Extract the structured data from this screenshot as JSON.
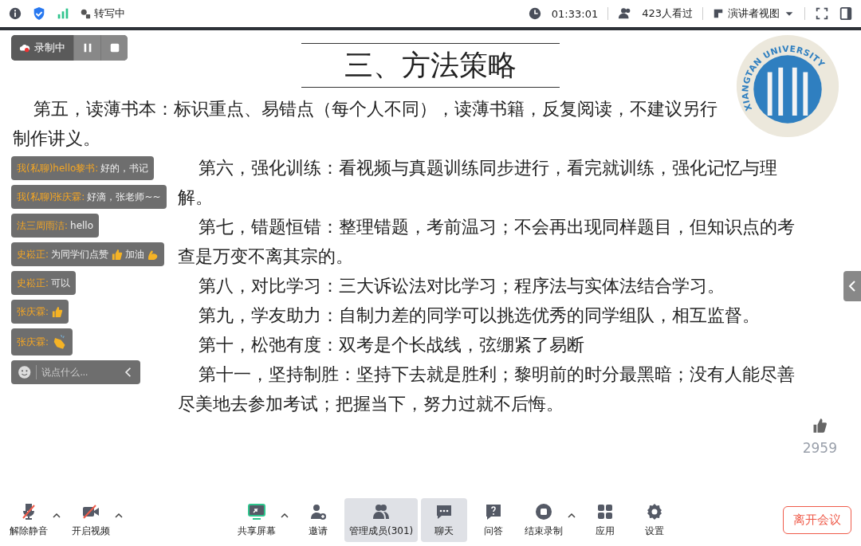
{
  "status_bar": {
    "transcribing": "转写中",
    "time": "01:33:01",
    "viewers": "423人看过",
    "view_mode": "演讲者视图"
  },
  "recording": {
    "label": "录制中"
  },
  "slide": {
    "title": "三、方法策略",
    "logo_text": "XIANGTAN UNIVERSITY",
    "paragraphs": [
      "第五，读薄书本：标识重点、易错点（每个人不同），读薄书籍，反复阅读，不建议另行制作讲义。",
      "第六，强化训练：看视频与真题训练同步进行，看完就训练，强化记忆与理解。",
      "第七，错题恒错：整理错题，考前温习；不会再出现同样题目，但知识点的考查是万变不离其宗的。",
      "第八，对比学习：三大诉讼法对比学习；程序法与实体法结合学习。",
      "第九，学友助力：自制力差的同学可以挑选优秀的同学组队，相互监督。",
      "第十，松弛有度：双考是个长战线，弦绷紧了易断",
      "第十一，坚持制胜：坚持下去就是胜利；黎明前的时分最黑暗；没有人能尽善尽美地去参加考试；把握当下，努力过就不后悔。"
    ]
  },
  "chat": {
    "messages": [
      {
        "sender": "我(私聊)hello黎书:",
        "parts": [
          {
            "kind": "text",
            "text": "好的，书记"
          }
        ]
      },
      {
        "sender": "我(私聊)张庆霖:",
        "parts": [
          {
            "kind": "text",
            "text": "好滴，张老师~~"
          }
        ]
      },
      {
        "sender": "法三周雨洁:",
        "parts": [
          {
            "kind": "text",
            "text": "hello"
          }
        ]
      },
      {
        "sender": "史崧正:",
        "parts": [
          {
            "kind": "text",
            "text": "为同学们点赞"
          },
          {
            "kind": "thumbs"
          },
          {
            "kind": "text",
            "text": "加油"
          },
          {
            "kind": "muscle"
          }
        ]
      },
      {
        "sender": "史崧正:",
        "parts": [
          {
            "kind": "text",
            "text": "可以"
          }
        ]
      },
      {
        "sender": "张庆霖:",
        "parts": [
          {
            "kind": "thumbs"
          }
        ]
      },
      {
        "sender": "张庆霖:",
        "parts": [
          {
            "kind": "clap"
          }
        ]
      }
    ],
    "placeholder": "说点什么..."
  },
  "likes": {
    "count": "2959"
  },
  "toolbar": {
    "items": [
      {
        "kind": "mic-off",
        "label": "解除静音",
        "caret": true,
        "selected": false
      },
      {
        "kind": "video-off",
        "label": "开启视频",
        "caret": true,
        "selected": false
      },
      {
        "kind": "share",
        "label": "共享屏幕",
        "caret": true,
        "selected": false
      },
      {
        "kind": "invite",
        "label": "邀请",
        "caret": false,
        "selected": false
      },
      {
        "kind": "members",
        "label": "管理成员(301)",
        "caret": false,
        "selected": true
      },
      {
        "kind": "chat",
        "label": "聊天",
        "caret": false,
        "selected": true
      },
      {
        "kind": "qa",
        "label": "问答",
        "caret": false,
        "selected": false
      },
      {
        "kind": "record-stop",
        "label": "结束录制",
        "caret": true,
        "selected": false
      },
      {
        "kind": "apps",
        "label": "应用",
        "caret": false,
        "selected": false
      },
      {
        "kind": "settings",
        "label": "设置",
        "caret": false,
        "selected": false
      }
    ]
  },
  "leave_button": "离开会议"
}
